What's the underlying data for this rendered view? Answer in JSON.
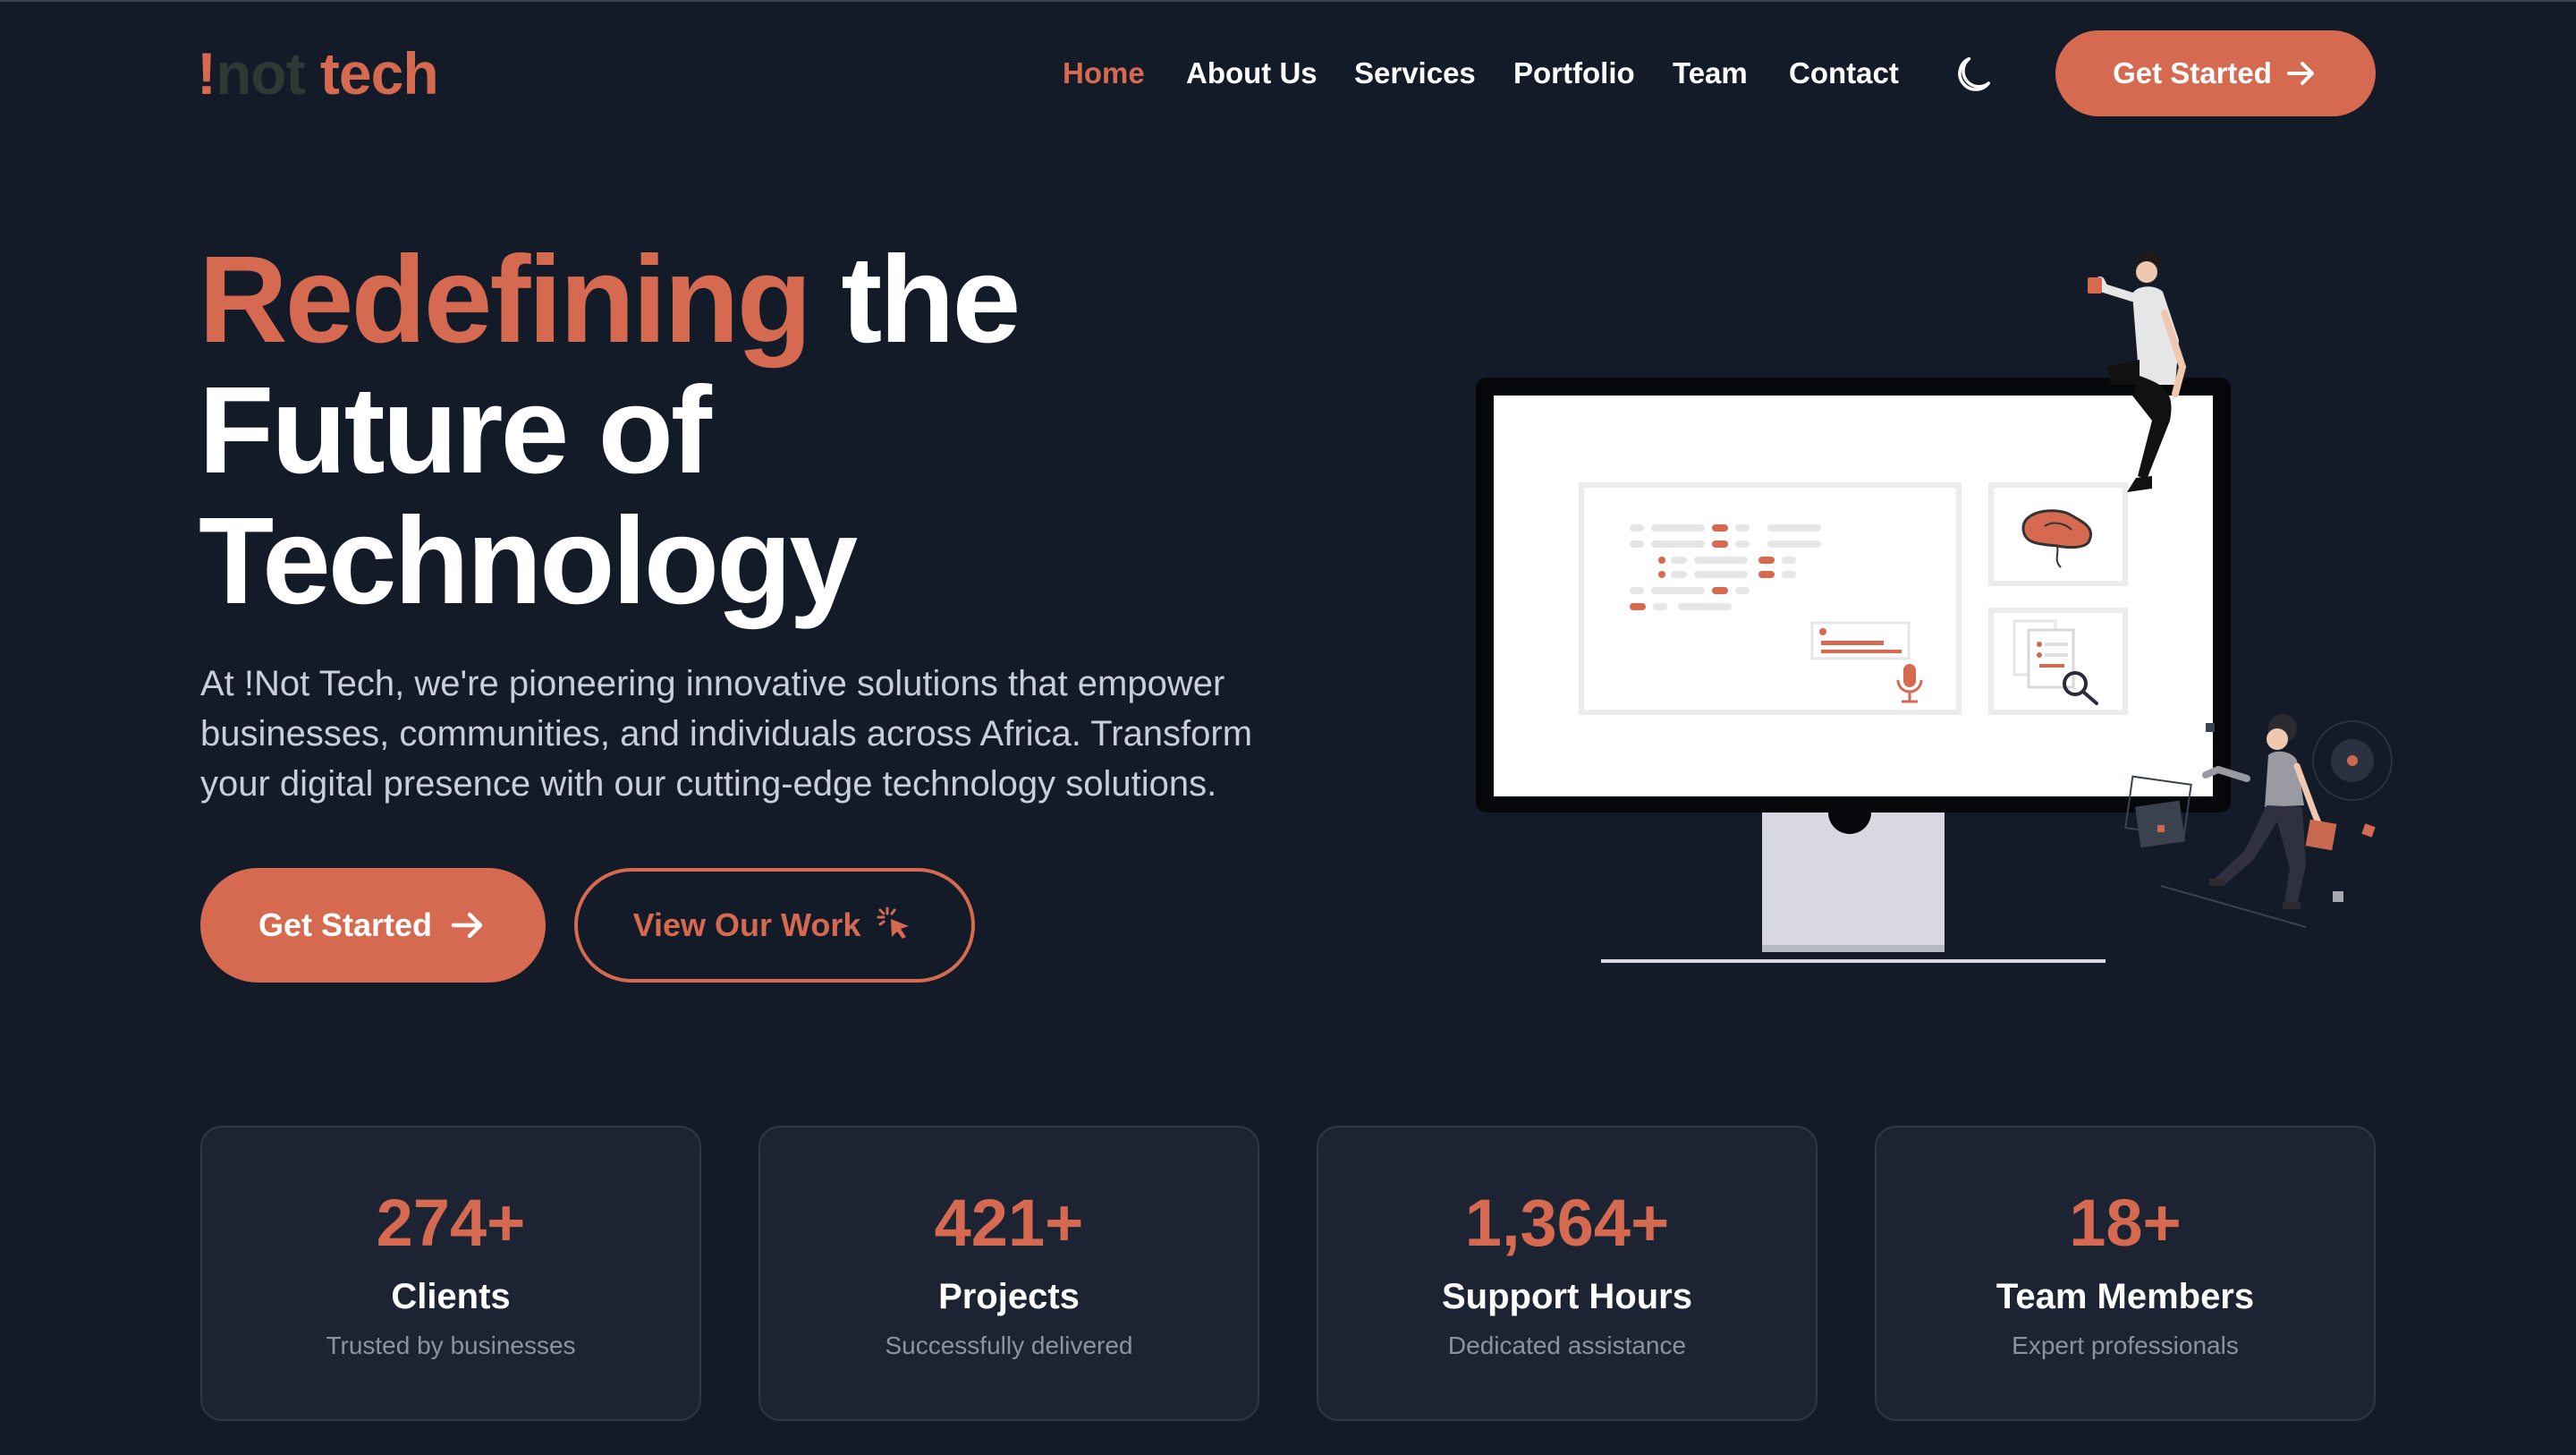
{
  "brand": {
    "logo_bang": "!",
    "logo_not": "not",
    "logo_tech": " tech"
  },
  "nav": {
    "items": [
      {
        "label": "Home",
        "active": true
      },
      {
        "label": "About Us"
      },
      {
        "label": "Services"
      },
      {
        "label": "Portfolio"
      },
      {
        "label": "Team"
      },
      {
        "label": "Contact"
      }
    ],
    "theme_toggle_icon": "moon-icon",
    "cta_label": "Get Started",
    "cta_icon": "arrow-right-icon"
  },
  "hero": {
    "title_accent": "Redefining",
    "title_rest_1": " the",
    "title_line_2": "Future of",
    "title_line_3": "Technology",
    "description": "At !Not Tech, we're pioneering innovative solutions that empower businesses, communities, and individuals across Africa. Transform your digital presence with our cutting-edge technology solutions.",
    "primary_button": "Get Started",
    "primary_icon": "arrow-right-icon",
    "secondary_button": "View Our Work",
    "secondary_icon": "pointer-click-icon"
  },
  "stats": [
    {
      "value": "274+",
      "label": "Clients",
      "sub": "Trusted by businesses"
    },
    {
      "value": "421+",
      "label": "Projects",
      "sub": "Successfully delivered"
    },
    {
      "value": "1,364+",
      "label": "Support Hours",
      "sub": "Dedicated assistance"
    },
    {
      "value": "18+",
      "label": "Team Members",
      "sub": "Expert professionals"
    }
  ],
  "colors": {
    "accent": "#d66a50",
    "background": "#131a28",
    "card": "#1c2434",
    "muted_text": "#8b93a3"
  }
}
